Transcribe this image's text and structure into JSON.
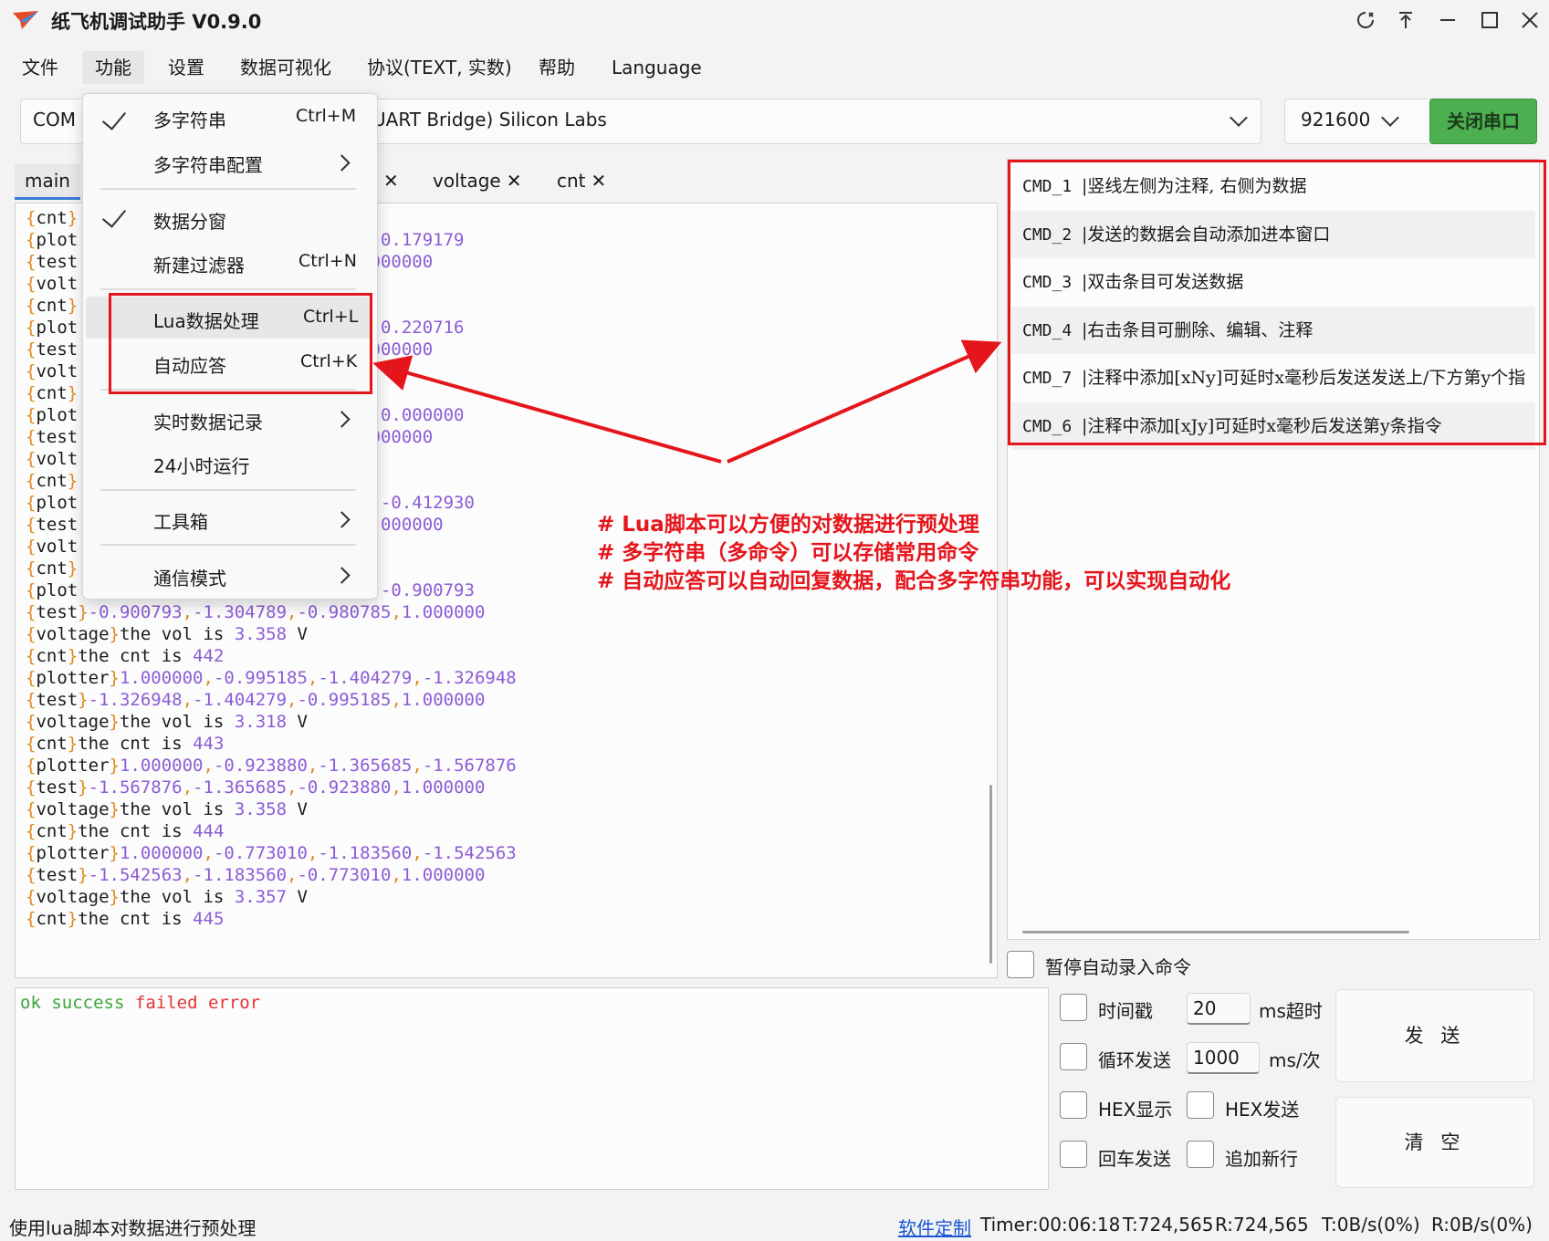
{
  "app": {
    "title": "纸飞机调试助手 V0.9.0"
  },
  "window_controls": [
    "pin-icon",
    "always-on-top-icon",
    "minimize-icon",
    "maximize-icon",
    "close-icon"
  ],
  "menubar": [
    "文件",
    "功能",
    "设置",
    "数据可视化",
    "协议(TEXT, 实数)",
    "帮助",
    "Language"
  ],
  "port": {
    "value_left": "COM",
    "value_right": "UART Bridge) Silicon Labs",
    "baud": "921600",
    "close_label": "关闭串口"
  },
  "tabs": [
    "main",
    "voltage",
    "cnt"
  ],
  "dropdown": {
    "items": [
      {
        "label": "多字符串",
        "shortcut": "Ctrl+M",
        "checked": true
      },
      {
        "label": "多字符串配置",
        "submenu": true
      },
      {
        "label": "数据分窗",
        "checked": true
      },
      {
        "label": "新建过滤器",
        "shortcut": "Ctrl+N"
      },
      {
        "label": "Lua数据处理",
        "shortcut": "Ctrl+L"
      },
      {
        "label": "自动应答",
        "shortcut": "Ctrl+K"
      },
      {
        "label": "实时数据记录",
        "submenu": true
      },
      {
        "label": "24小时运行"
      },
      {
        "label": "工具箱",
        "submenu": true
      },
      {
        "label": "通信模式",
        "submenu": true
      }
    ]
  },
  "output": {
    "partial_lines": [
      {
        "tag": "cnt",
        "rest": ""
      },
      {
        "tag": "plot",
        "rest": "73418,0.179179"
      },
      {
        "tag": "test",
        "rest": "90,1.000000"
      },
      {
        "tag": "volt",
        "rest": ""
      },
      {
        "tag": "cnt",
        "rest": ""
      },
      {
        "tag": "plot",
        "rest": "78481,0.220716"
      },
      {
        "tag": "test",
        "rest": "97,1.000000"
      },
      {
        "tag": "volt",
        "rest": ""
      },
      {
        "tag": "cnt",
        "rest": ""
      },
      {
        "tag": "plot",
        "rest": "00000,0.000000"
      },
      {
        "tag": "test",
        "rest": "07,1.000000"
      },
      {
        "tag": "volt",
        "rest": ""
      },
      {
        "tag": "cnt",
        "rest": ""
      },
      {
        "tag": "plot",
        "rest": "90775,-0.412930"
      },
      {
        "tag": "test",
        "rest": "921,1.000000"
      },
      {
        "tag": "volt",
        "rest": ""
      },
      {
        "tag": "cnt",
        "rest": ""
      },
      {
        "tag": "plot",
        "rest": "04789,-0.900793"
      }
    ],
    "full_lines": [
      {
        "tag": "test",
        "text": "-0.900793,-1.304789,-0.980785,1.000000"
      },
      {
        "tag": "voltage",
        "text": "the vol is 3.358 V"
      },
      {
        "tag": "cnt",
        "text": "the cnt is 442"
      },
      {
        "tag": "plotter",
        "text": "1.000000,-0.995185,-1.404279,-1.326948"
      },
      {
        "tag": "test",
        "text": "-1.326948,-1.404279,-0.995185,1.000000"
      },
      {
        "tag": "voltage",
        "text": "the vol is 3.318 V"
      },
      {
        "tag": "cnt",
        "text": "the cnt is 443"
      },
      {
        "tag": "plotter",
        "text": "1.000000,-0.923880,-1.365685,-1.567876"
      },
      {
        "tag": "test",
        "text": "-1.567876,-1.365685,-0.923880,1.000000"
      },
      {
        "tag": "voltage",
        "text": "the vol is 3.358 V"
      },
      {
        "tag": "cnt",
        "text": "the cnt is 444"
      },
      {
        "tag": "plotter",
        "text": "1.000000,-0.773010,-1.183560,-1.542563"
      },
      {
        "tag": "test",
        "text": "-1.542563,-1.183560,-0.773010,1.000000"
      },
      {
        "tag": "voltage",
        "text": "the vol is 3.357 V"
      },
      {
        "tag": "cnt",
        "text": "the cnt is 445"
      }
    ]
  },
  "commands": [
    {
      "id": "CMD_1",
      "text": "|竖线左侧为注释, 右侧为数据"
    },
    {
      "id": "CMD_2",
      "text": "|发送的数据会自动添加进本窗口"
    },
    {
      "id": "CMD_3",
      "text": "|双击条目可发送数据"
    },
    {
      "id": "CMD_4",
      "text": "|右击条目可删除、编辑、注释"
    },
    {
      "id": "CMD_7",
      "text": "|注释中添加[xNy]可延时x毫秒后发送发送上/下方第y个指"
    },
    {
      "id": "CMD_6",
      "text": "|注释中添加[xJy]可延时x毫秒后发送第y条指令"
    }
  ],
  "annotations": [
    "# Lua脚本可以方便的对数据进行预处理",
    "# 多字符串（多命令）可以存储常用命令",
    "# 自动应答可以自动回复数据，配合多字符串功能，可以实现自动化"
  ],
  "pause_record_label": "暂停自动录入命令",
  "input": {
    "ok": "ok",
    "success": "success",
    "failed": "failed",
    "error": "error"
  },
  "send_options": {
    "timestamp": "时间戳",
    "timeout_value": "20",
    "timeout_unit": "ms超时",
    "loop_send": "循环发送",
    "loop_value": "1000",
    "loop_unit": "ms/次",
    "hex_display": "HEX显示",
    "hex_send": "HEX发送",
    "enter_send": "回车发送",
    "append_newline": "追加新行",
    "send_button": "发 送",
    "clear_button": "清 空"
  },
  "status": {
    "message": "使用lua脚本对数据进行预处理",
    "link": "软件定制",
    "timer": "Timer:00:06:18",
    "tx": "T:724,565",
    "rx": "R:724,565",
    "tx_rate": "T:0B/s(0%)",
    "rx_rate": "R:0B/s(0%)"
  },
  "colors": {
    "accent_red": "#e5151c",
    "port_button": "#4caf50",
    "bracket": "#e08a1e",
    "number": "#8c5cd6"
  }
}
